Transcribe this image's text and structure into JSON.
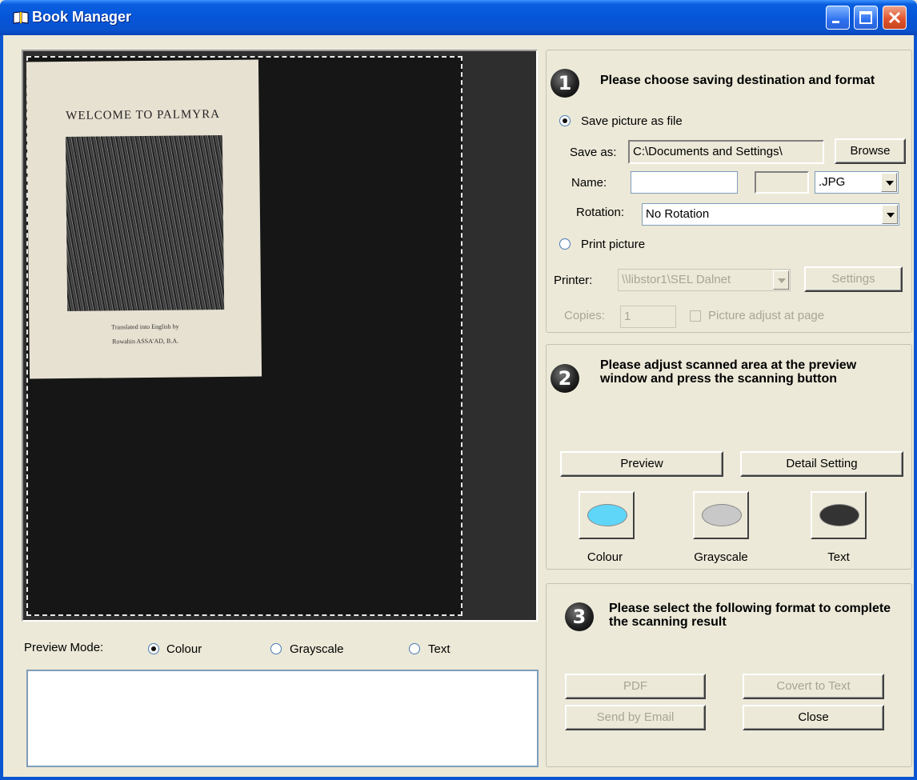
{
  "window": {
    "title": "Book Manager"
  },
  "preview": {
    "book_title": "WELCOME TO PALMYRA",
    "book_caption_1": "Translated into English by",
    "book_caption_2": "Rowahin ASSA'AD, B.A."
  },
  "preview_mode": {
    "label": "Preview Mode:",
    "options": [
      "Colour",
      "Grayscale",
      "Text"
    ],
    "selected": "Colour"
  },
  "step1": {
    "number": "1",
    "title": "Please choose saving destination and format",
    "save_file_label": "Save picture as file",
    "save_as_label": "Save as:",
    "save_as_value": "C:\\Documents and Settings\\",
    "browse_label": "Browse",
    "name_label": "Name:",
    "name_value": "",
    "counter_value": "",
    "format_value": ".JPG",
    "rotation_label": "Rotation:",
    "rotation_value": "No Rotation",
    "print_label": "Print picture",
    "printer_label": "Printer:",
    "printer_value": "\\\\libstor1\\SEL Dalnet",
    "settings_label": "Settings",
    "copies_label": "Copies:",
    "copies_value": "1",
    "adjust_label": "Picture adjust at page",
    "selected": "Save picture as file"
  },
  "step2": {
    "number": "2",
    "title": "Please adjust scanned area at the preview window and press the scanning button",
    "preview_label": "Preview",
    "detail_label": "Detail Setting",
    "modes": [
      {
        "label": "Colour",
        "color": "#5fd6f8"
      },
      {
        "label": "Grayscale",
        "color": "#c8c8c8"
      },
      {
        "label": "Text",
        "color": "#333333"
      }
    ]
  },
  "step3": {
    "number": "3",
    "title": "Please select the following format to complete the scanning result",
    "pdf_label": "PDF",
    "convert_label": "Covert to Text",
    "email_label": "Send by Email",
    "close_label": "Close"
  },
  "colors": {
    "titlebar": "#0a5fdf",
    "window_bg": "#ece9d8",
    "preview_bg": "#2e2e2e",
    "close_button": "#e0562f"
  }
}
